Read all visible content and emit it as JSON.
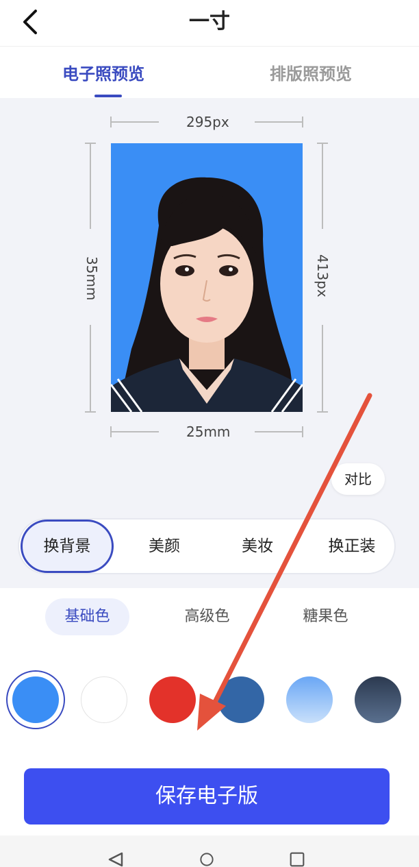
{
  "header": {
    "title": "一寸",
    "back_icon": "chevron-left-icon"
  },
  "tabs": [
    {
      "label": "电子照预览",
      "active": true
    },
    {
      "label": "排版照预览",
      "active": false
    }
  ],
  "preview": {
    "width_px": "295px",
    "height_px": "413px",
    "width_mm": "25mm",
    "height_mm": "35mm",
    "background_color": "#3a8ef5"
  },
  "compare_label": "对比",
  "tools": [
    "换背景",
    "美颜",
    "美妆",
    "换正装"
  ],
  "color_tabs": [
    "基础色",
    "高级色",
    "糖果色"
  ],
  "swatches": [
    {
      "name": "blue",
      "color": "#3a8ef5",
      "selected": true
    },
    {
      "name": "white",
      "color": "#ffffff",
      "selected": false
    },
    {
      "name": "red",
      "color": "#e3322a",
      "selected": false
    },
    {
      "name": "dark-blue",
      "color": "#3366a6",
      "selected": false
    },
    {
      "name": "gradient-light-blue",
      "color": "#8bbcf6",
      "selected": false
    },
    {
      "name": "gradient-dark-slate",
      "color": "#3b4f6a",
      "selected": false
    }
  ],
  "save_label": "保存电子版",
  "nav": {
    "back": "nav-back-icon",
    "home": "nav-home-icon",
    "recent": "nav-recent-icon"
  },
  "annotation_color": "#e4523c"
}
